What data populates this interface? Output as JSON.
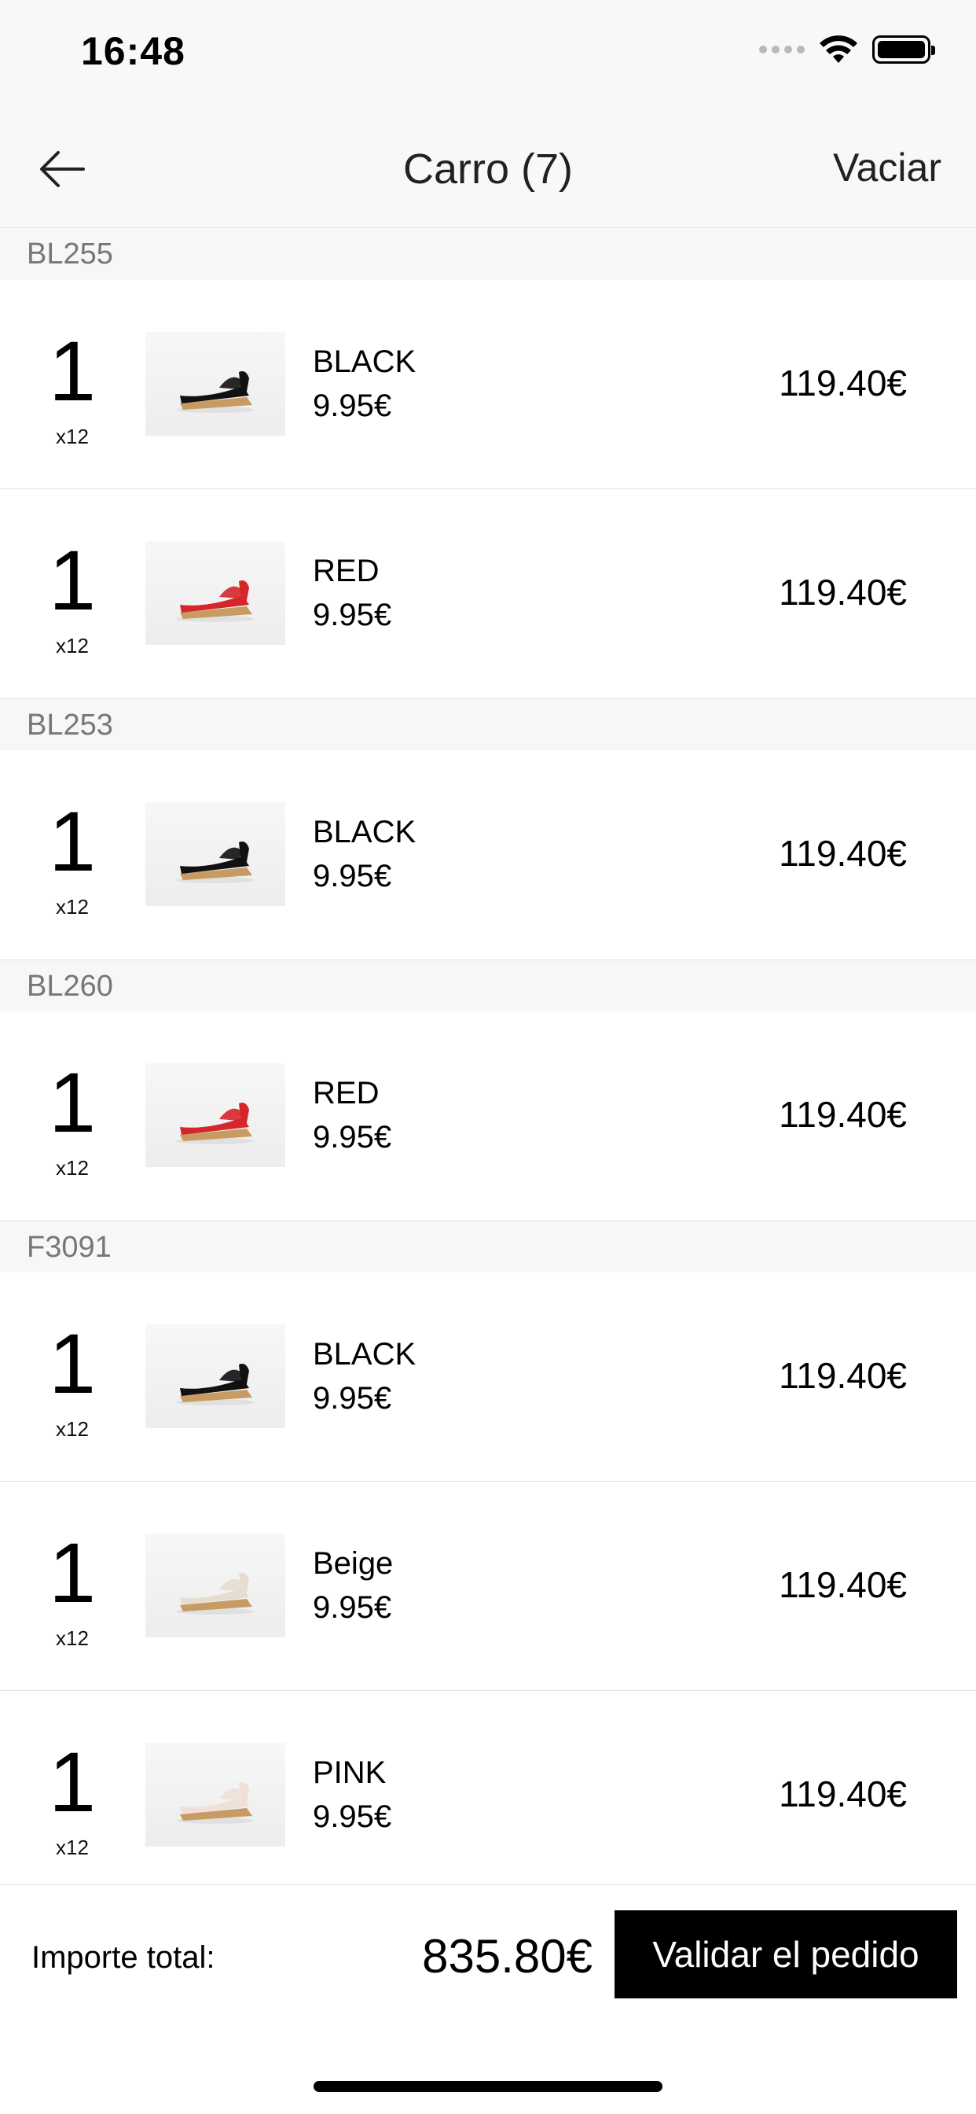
{
  "status_bar": {
    "time": "16:48"
  },
  "nav": {
    "title": "Carro (7)",
    "action": "Vaciar"
  },
  "sections": [
    {
      "code": "BL255",
      "items": [
        {
          "qty": "1",
          "mult": "x12",
          "color": "BLACK",
          "unit_price": "9.95€",
          "total": "119.40€",
          "image": "black-wedge-sandal"
        },
        {
          "qty": "1",
          "mult": "x12",
          "color": "RED",
          "unit_price": "9.95€",
          "total": "119.40€",
          "image": "red-wedge-sandal"
        }
      ]
    },
    {
      "code": "BL253",
      "items": [
        {
          "qty": "1",
          "mult": "x12",
          "color": "BLACK",
          "unit_price": "9.95€",
          "total": "119.40€",
          "image": "black-wedge-sandal"
        }
      ]
    },
    {
      "code": "BL260",
      "items": [
        {
          "qty": "1",
          "mult": "x12",
          "color": "RED",
          "unit_price": "9.95€",
          "total": "119.40€",
          "image": "red-wedge-sandal"
        }
      ]
    },
    {
      "code": "F3091",
      "items": [
        {
          "qty": "1",
          "mult": "x12",
          "color": "BLACK",
          "unit_price": "9.95€",
          "total": "119.40€",
          "image": "black-wedge-sandal"
        },
        {
          "qty": "1",
          "mult": "x12",
          "color": "Beige",
          "unit_price": "9.95€",
          "total": "119.40€",
          "image": "beige-wedge-sandal"
        },
        {
          "qty": "1",
          "mult": "x12",
          "color": "PINK",
          "unit_price": "9.95€",
          "total": "119.40€",
          "image": "pink-wedge-sandal"
        }
      ]
    }
  ],
  "footer": {
    "total_label": "Importe total:",
    "total_value": "835.80€",
    "validate_label": "Validar el pedido"
  },
  "colors": {
    "black": "#111111",
    "red": "#d6262b",
    "beige": "#e6ddd0",
    "pink": "#efe0d8",
    "cork": "#c89b63"
  }
}
